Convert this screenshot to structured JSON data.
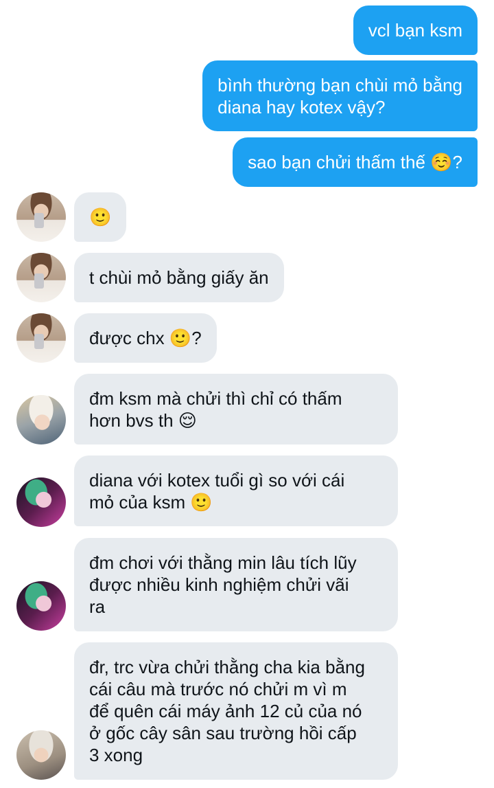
{
  "messages": [
    {
      "id": "m1",
      "direction": "out",
      "text": "vcl bạn ksm"
    },
    {
      "id": "m2",
      "direction": "out",
      "text": "bình thường bạn chùi mỏ bằng\ndiana hay kotex vậy?"
    },
    {
      "id": "m3",
      "direction": "out",
      "text": "sao bạn chửi thấm thế ☺️?"
    },
    {
      "id": "m4",
      "direction": "in",
      "avatar": "avatar-user-a",
      "text": "🙂"
    },
    {
      "id": "m5",
      "direction": "in",
      "avatar": "avatar-user-a",
      "text": "t chùi mỏ bằng giấy ăn"
    },
    {
      "id": "m6",
      "direction": "in",
      "avatar": "avatar-user-a",
      "text": "được chx 🙂?"
    },
    {
      "id": "m7",
      "direction": "in",
      "avatar": "avatar-user-b",
      "text": "đm ksm mà chửi thì chỉ có thấm\nhơn bvs th 😌"
    },
    {
      "id": "m8",
      "direction": "in",
      "avatar": "avatar-user-c",
      "text": "diana với kotex tuổi gì so với cái\nmỏ của ksm 🙂"
    },
    {
      "id": "m9",
      "direction": "in",
      "avatar": "avatar-user-c",
      "text": "đm chơi với thằng min lâu tích lũy\nđược nhiều kinh nghiệm chửi vãi\nra"
    },
    {
      "id": "m10",
      "direction": "in",
      "avatar": "avatar-user-d",
      "text": "đr, trc vừa chửi thằng cha kia bằng\ncái câu mà trước nó chửi m vì m\nđể quên cái máy ảnh 12 củ của nó\nở gốc cây sân sau trường hồi cấp\n3 xong"
    }
  ],
  "colors": {
    "outgoing_bubble": "#1da1f2",
    "incoming_bubble": "#e7ebef",
    "incoming_text": "#0f1419",
    "outgoing_text": "#ffffff"
  }
}
